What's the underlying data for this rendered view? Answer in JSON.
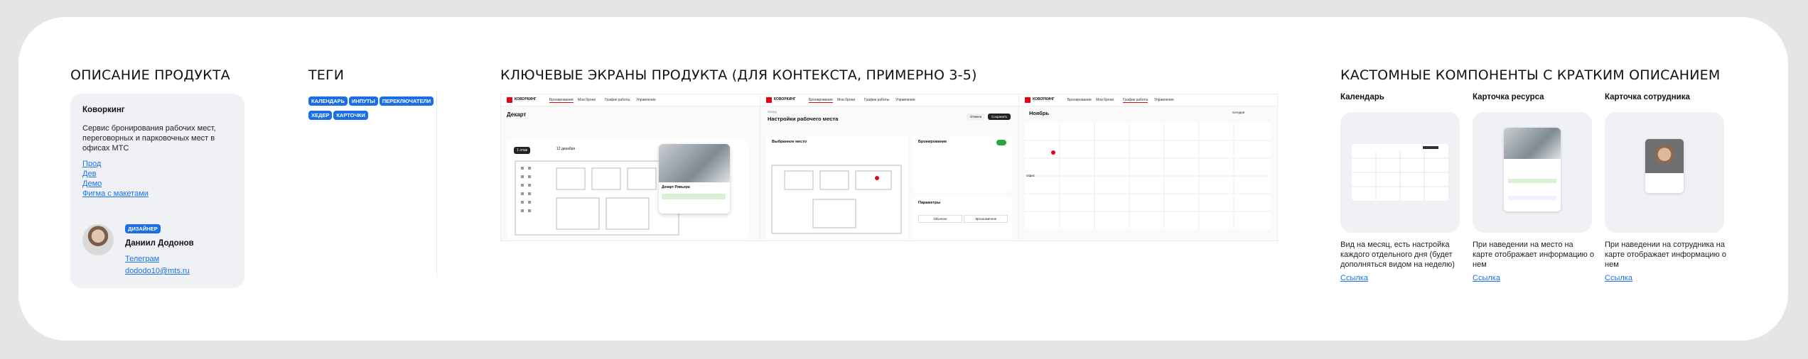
{
  "sections": {
    "product": "Описание продукта",
    "tags": "Теги",
    "screens": "Ключевые экраны продукта (для контекста, примерно 3-5)",
    "components": "Кастомные компоненты с кратким описанием"
  },
  "product": {
    "title": "Коворкинг",
    "description": "Сервис бронирования рабочих мест, переговорных и парковочных мест в офисах МТС",
    "links": [
      "Прод",
      "Дев",
      "Демо",
      "Фигма с макетами"
    ],
    "role_badge": "Дизайнер",
    "person_name": "Даниил Додонов",
    "person_links": [
      "Телеграм",
      "dododo10@mts.ru"
    ]
  },
  "tags": [
    "Календарь",
    "Инпуты",
    "Переключатели",
    "Хедер",
    "Карточки"
  ],
  "screens": {
    "logo": "КОВОРКИНГ",
    "nav": [
      "Бронирования",
      "Мои брони",
      "График работы",
      "Управление"
    ],
    "s1": {
      "title": "Декарт",
      "floor_btn": "1 этаж",
      "date": "12 декабря",
      "popup_title": "Декарт Ривьера"
    },
    "s2": {
      "back": "Назад",
      "title": "Настройки рабочего места",
      "btn_cancel": "Отмена",
      "btn_save": "Сохранить",
      "panel_left": "Выбранное место",
      "panel_right": "Бронирование",
      "params": "Параметры",
      "opt1": "Обычное",
      "opt2": "Эргономичное"
    },
    "s3": {
      "title": "Ноябрь",
      "btn": "Сегодня",
      "event": "Офис"
    }
  },
  "components": [
    {
      "title": "Календарь",
      "description": "Вид на месяц, есть настройка каждого отдельного дня (будет дополняться видом на неделю)",
      "link": "Ссылка"
    },
    {
      "title": "Карточка ресурса",
      "description": "При наведении на место на карте отображает информацию о нем",
      "link": "Ссылка"
    },
    {
      "title": "Карточка сотрудника",
      "description": "При наведении на сотрудника на карте отображает информацию о нем",
      "link": "Ссылка"
    }
  ],
  "colors": {
    "accent": "#1a6ee8",
    "brand": "#e30611",
    "card_bg": "#f0f1f4",
    "board_bg": "#ffffff"
  }
}
